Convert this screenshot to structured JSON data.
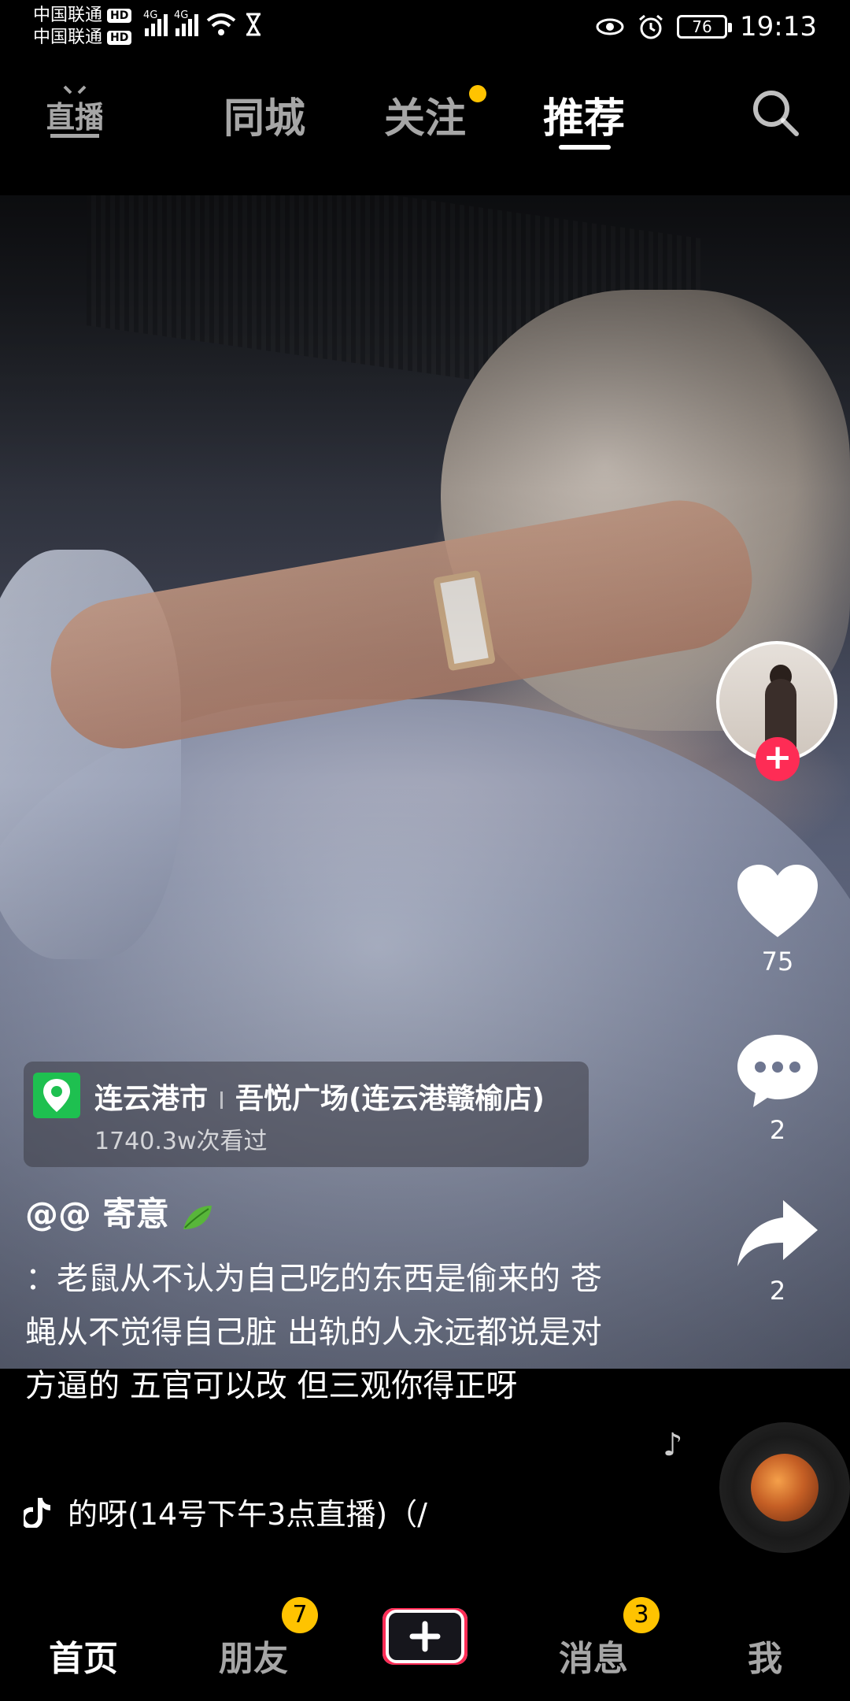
{
  "status_bar": {
    "carrier_1": "中国联通",
    "carrier_2": "中国联通",
    "hd_label": "HD",
    "network_1": "4G",
    "network_2": "4G",
    "battery": "76",
    "time": "19:13",
    "icons": [
      "signal-icon",
      "wifi-icon",
      "hourglass-icon",
      "eye-icon",
      "alarm-icon",
      "battery-icon"
    ]
  },
  "top_nav": {
    "live_label": "直播",
    "tabs": [
      {
        "label": "同城",
        "active": false
      },
      {
        "label": "关注",
        "active": false,
        "has_dot": true
      },
      {
        "label": "推荐",
        "active": true
      }
    ]
  },
  "actions": {
    "likes": "75",
    "comments": "2",
    "shares": "2"
  },
  "location": {
    "city": "连云港市",
    "place": "吾悦广场(连云港赣榆店)",
    "views": "1740.3w次看过"
  },
  "post": {
    "author": "@@ 寄意",
    "caption": "：老鼠从不认为自己吃的东西是偷来的 苍蝇从不觉得自己脏 出轨的人永远都说是对方逼的 五官可以改 但三观你得正呀",
    "music": "的呀(14号下午3点直播)（/"
  },
  "bottom_nav": {
    "items": [
      {
        "label": "首页",
        "active": true
      },
      {
        "label": "朋友",
        "badge": "7"
      },
      {
        "label": "消息",
        "badge": "3"
      },
      {
        "label": "我"
      }
    ]
  },
  "colors": {
    "accent_red": "#fe2c55",
    "badge_yellow": "#ffc300",
    "location_green": "#1ec050"
  }
}
